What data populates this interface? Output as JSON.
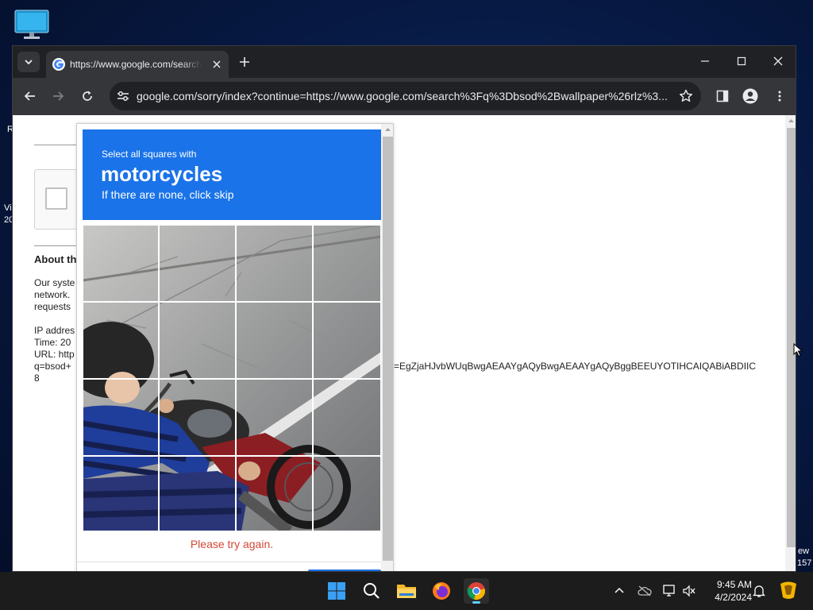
{
  "desktop": {
    "edge_text_left_1": "R",
    "edge_text_left_2": "Vi",
    "edge_text_left_3": "20",
    "edge_text_right_1": "ew",
    "edge_text_right_2": "157"
  },
  "tab": {
    "title": "https://www.google.com/search"
  },
  "toolbar": {
    "url": "google.com/sorry/index?continue=https://www.google.com/search%3Fq%3Dbsod%2Bwallpaper%26rlz%3..."
  },
  "sorry_page": {
    "about_heading": "About th",
    "line1": "Our syste",
    "line2": "network.",
    "line3": "requests",
    "ip": "IP addres",
    "time": "Time: 20",
    "url": "URL: http",
    "q": "q=bsod+",
    "eight": "8",
    "long_param": "=EgZjaHJvbWUqBwgAEAAYgAQyBwgAEAAYgAQyBggBEEUYOTIHCAIQABiABDIIC"
  },
  "captcha": {
    "instruction": "Select all squares with",
    "target": "motorcycles",
    "hint": "If there are none, click skip",
    "error": "Please try again."
  },
  "taskbar": {
    "time": "9:45 AM",
    "date": "4/2/2024"
  },
  "colors": {
    "captcha_blue": "#1a73e8",
    "error_red": "#d14836",
    "browser_dark": "#202124"
  }
}
